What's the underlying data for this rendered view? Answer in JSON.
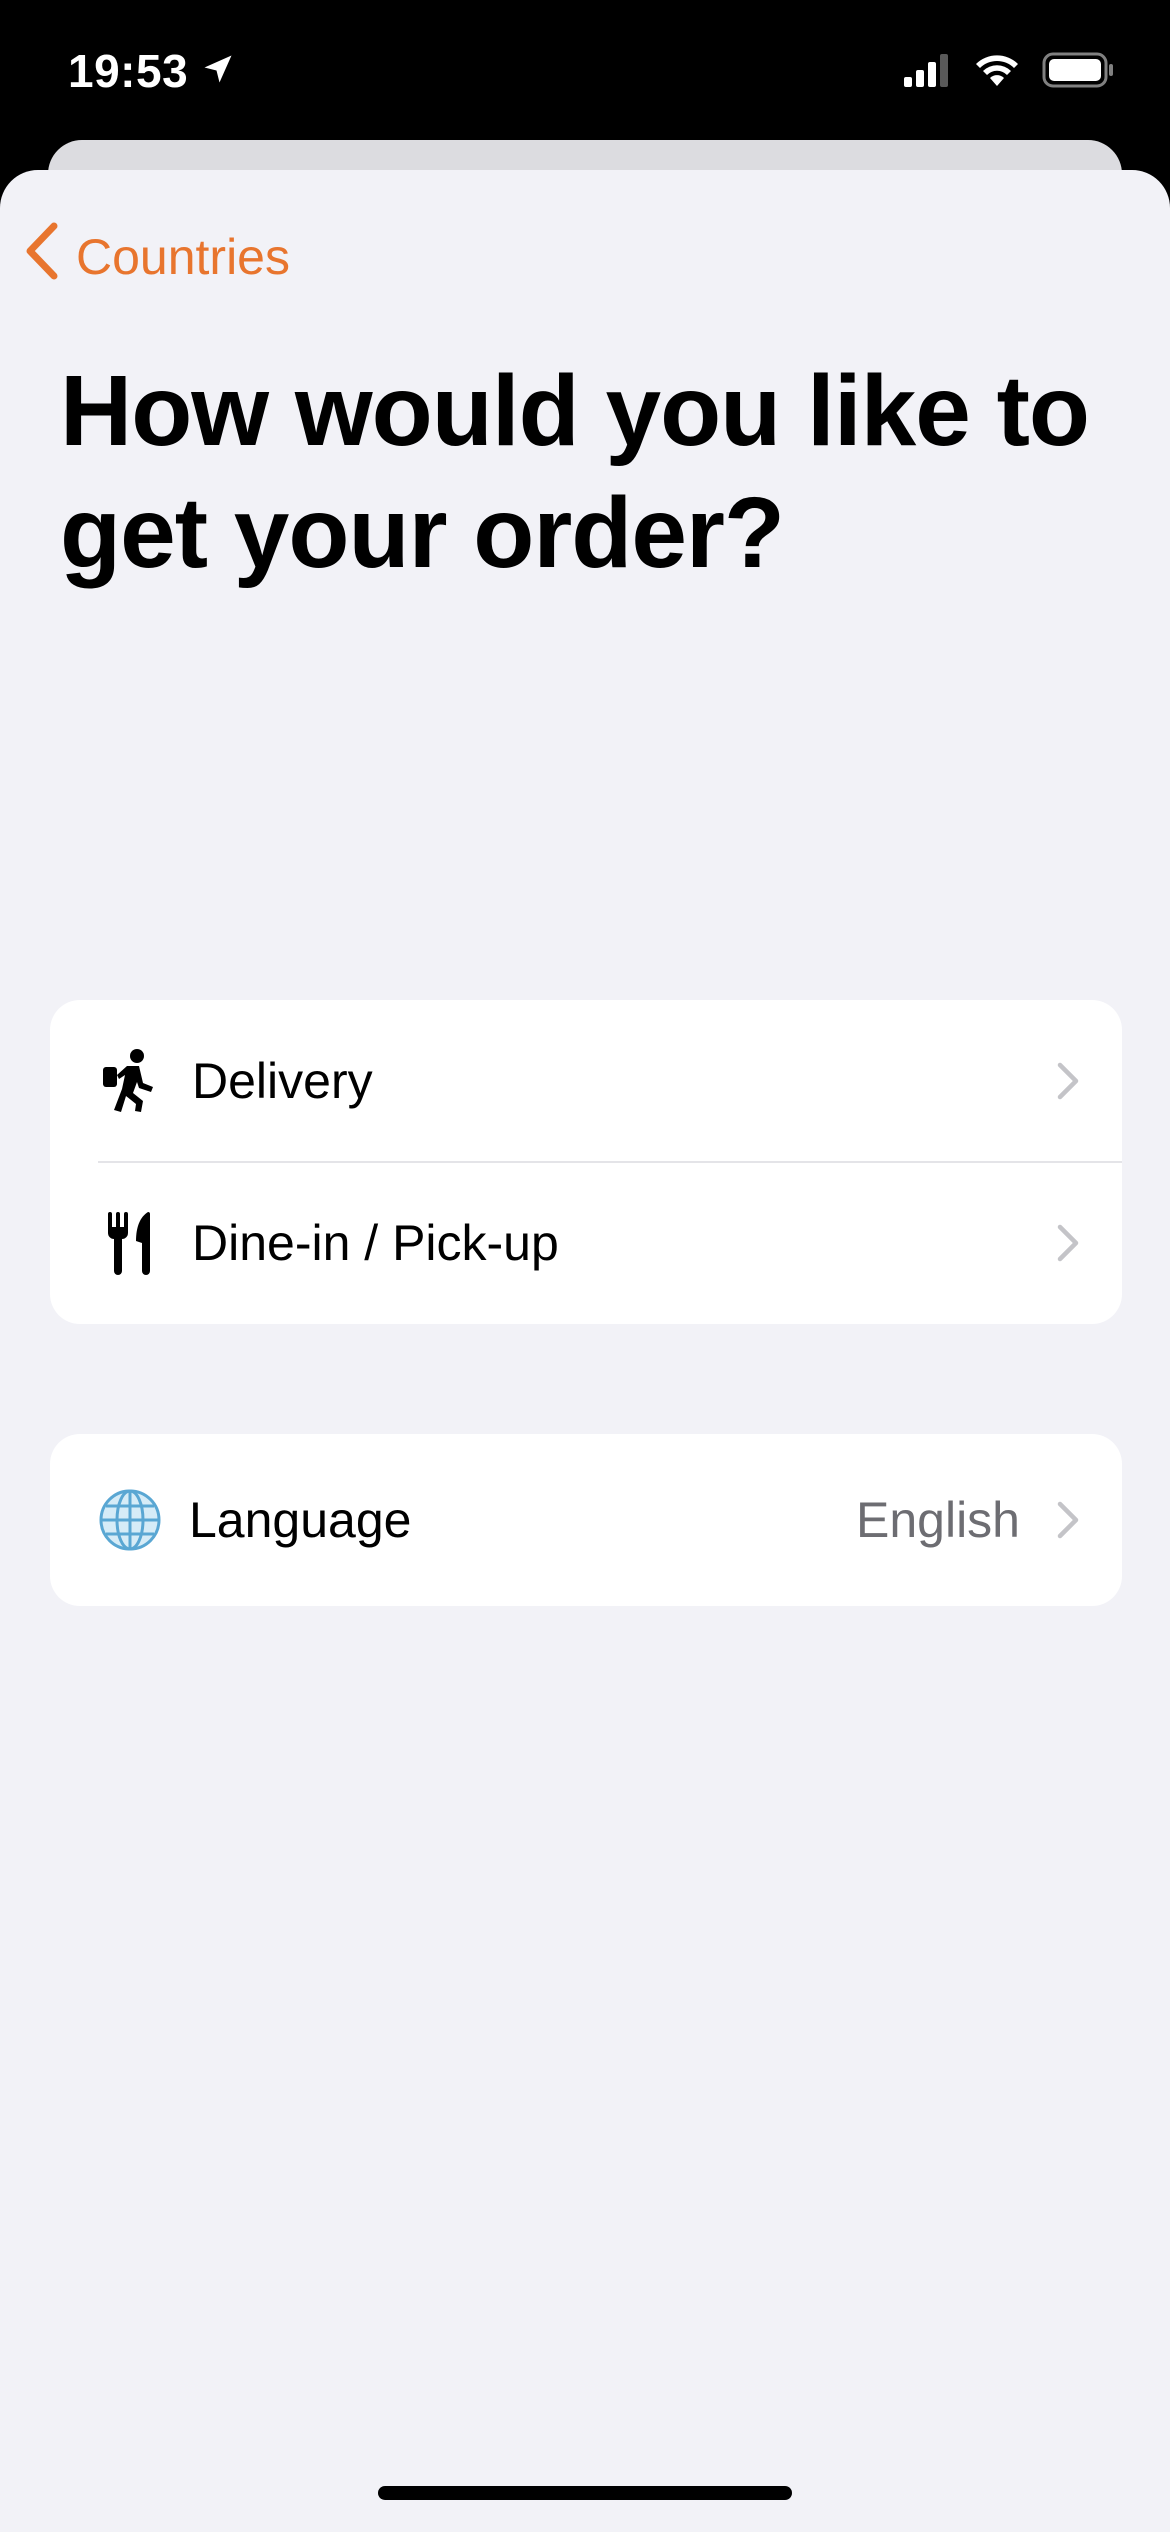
{
  "status_bar": {
    "time": "19:53",
    "icons": [
      "location-arrow-icon",
      "cellular-signal-icon",
      "wifi-icon",
      "battery-icon"
    ]
  },
  "nav": {
    "back_label": "Countries",
    "back_icon": "chevron-left-icon"
  },
  "title": "How would you like to get your order?",
  "order_options": [
    {
      "label": "Delivery",
      "icon": "delivery-runner-icon"
    },
    {
      "label": "Dine-in / Pick-up",
      "icon": "fork-knife-icon"
    }
  ],
  "language": {
    "label": "Language",
    "value": "English",
    "icon": "globe-icon"
  },
  "colors": {
    "accent": "#e8752e",
    "background": "#f2f2f7",
    "card": "#ffffff",
    "secondary_text": "#6d6d72",
    "chevron": "#c4c4c8"
  }
}
